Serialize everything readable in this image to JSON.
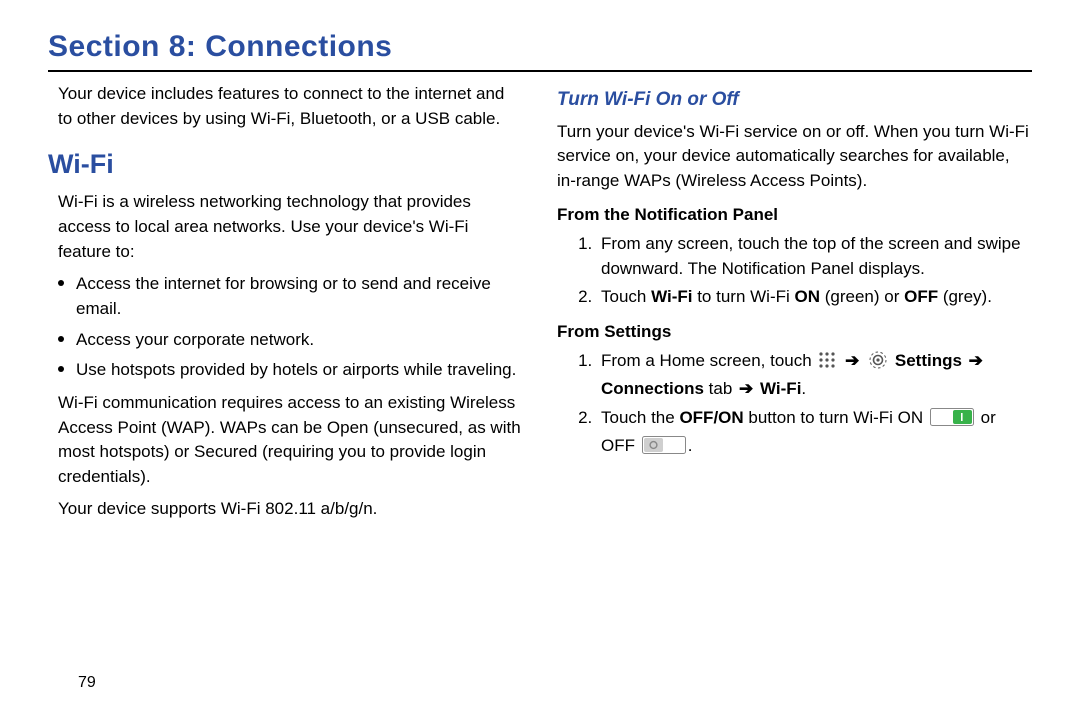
{
  "header": {
    "title": "Section 8: Connections"
  },
  "left": {
    "intro": "Your device includes features to connect to the internet and to other devices by using Wi-Fi, Bluetooth, or a USB cable.",
    "wifi_heading": "Wi-Fi",
    "wifi_desc": "Wi-Fi is a wireless networking technology that provides access to local area networks. Use your device's Wi-Fi feature to:",
    "bullets": [
      "Access the internet for browsing or to send and receive email.",
      "Access your corporate network.",
      "Use hotspots provided by hotels or airports while traveling."
    ],
    "wap": "Wi-Fi communication requires access to an existing Wireless Access Point (WAP). WAPs can be Open (unsecured, as with most hotspots) or Secured (requiring you to provide login credentials).",
    "support": "Your device supports Wi-Fi 802.11 a/b/g/n."
  },
  "right": {
    "sub_heading": "Turn Wi-Fi On or Off",
    "sub_intro": "Turn your device's Wi-Fi service on or off. When you turn Wi-Fi service on, your device automatically searches for available, in-range WAPs (Wireless Access Points).",
    "from_notif_heading": "From the Notification Panel",
    "notif_steps": {
      "s1": "From any screen, touch the top of the screen and swipe downward. The Notification Panel displays.",
      "s2_pre": "Touch ",
      "s2_wifi": "Wi-Fi",
      "s2_mid": " to turn Wi-Fi ",
      "s2_on": "ON",
      "s2_green": " (green) or ",
      "s2_off": "OFF",
      "s2_grey": " (grey)."
    },
    "from_settings_heading": "From Settings",
    "settings_steps": {
      "s1_pre": "From a Home screen, touch ",
      "arrow": "➔",
      "settings_word": "Settings",
      "conn_tab": "Connections",
      "tab_word": " tab ",
      "wifi_word": "Wi-Fi",
      "period": ".",
      "s2_pre": "Touch the ",
      "offon": "OFF/ON",
      "s2_mid": " button to turn Wi-Fi ON ",
      "s2_or": " or OFF ",
      "s2_end": "."
    }
  },
  "page_number": "79"
}
